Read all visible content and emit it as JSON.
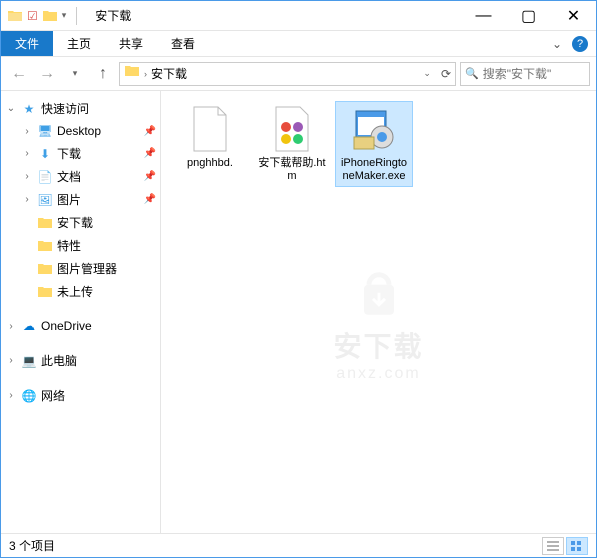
{
  "window": {
    "title": "安下载",
    "minimize": "—",
    "maximize": "▢",
    "close": "✕"
  },
  "ribbon": {
    "file": "文件",
    "home": "主页",
    "share": "共享",
    "view": "查看"
  },
  "nav": {
    "crumb1": "安下载",
    "search_placeholder": "搜索\"安下载\""
  },
  "sidebar": {
    "quick_access": "快速访问",
    "items": [
      {
        "label": "Desktop",
        "pin": true,
        "icon": "desktop"
      },
      {
        "label": "下载",
        "pin": true,
        "icon": "download"
      },
      {
        "label": "文档",
        "pin": true,
        "icon": "document"
      },
      {
        "label": "图片",
        "pin": true,
        "icon": "picture"
      },
      {
        "label": "安下载",
        "pin": false,
        "icon": "folder"
      },
      {
        "label": "特性",
        "pin": false,
        "icon": "folder"
      },
      {
        "label": "图片管理器",
        "pin": false,
        "icon": "folder"
      },
      {
        "label": "未上传",
        "pin": false,
        "icon": "folder"
      }
    ],
    "onedrive": "OneDrive",
    "thispc": "此电脑",
    "network": "网络"
  },
  "files": [
    {
      "name": "pnghhbd.",
      "type": "blank"
    },
    {
      "name": "安下载帮助.htm",
      "type": "htm"
    },
    {
      "name": "iPhoneRingtoneMaker.exe",
      "type": "exe",
      "selected": true
    }
  ],
  "status": {
    "count": "3 个项目"
  },
  "watermark": {
    "main": "安下载",
    "sub": "anxz.com"
  }
}
